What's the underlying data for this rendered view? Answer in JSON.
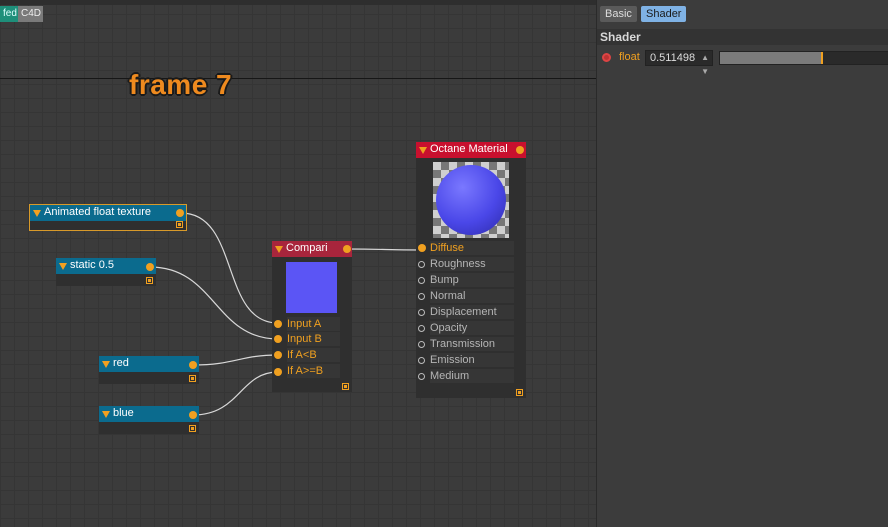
{
  "canvas": {
    "mode_tabs": [
      "fed",
      "C4D"
    ],
    "frame_label": "frame 7"
  },
  "nodes": {
    "animated_float": {
      "title": "Animated float texture"
    },
    "static": {
      "title": "static 0.5"
    },
    "red": {
      "title": "red"
    },
    "blue": {
      "title": "blue"
    },
    "compare": {
      "title": "Compari",
      "preview_color": "#5b55f5",
      "inputs": [
        "Input A",
        "Input B",
        "If A<B",
        "If A>=B"
      ]
    },
    "octane_material": {
      "title": "Octane Material",
      "sphere_color": "#4a47e8",
      "inputs": [
        "Diffuse",
        "Roughness",
        "Bump",
        "Normal",
        "Displacement",
        "Opacity",
        "Transmission",
        "Emission",
        "Medium"
      ]
    }
  },
  "panel": {
    "tabs": [
      "Basic",
      "Shader"
    ],
    "active_tab": "Shader",
    "section_title": "Shader",
    "float_label": "float",
    "float_value": "0.511498",
    "slider_fraction": 0.6
  },
  "colors": {
    "accent": "#f0a020",
    "node_header_teal": "#0b6b8e",
    "node_header_compare": "#a8253c",
    "node_header_material": "#c8102e",
    "tab_active": "#7fb2e5"
  }
}
